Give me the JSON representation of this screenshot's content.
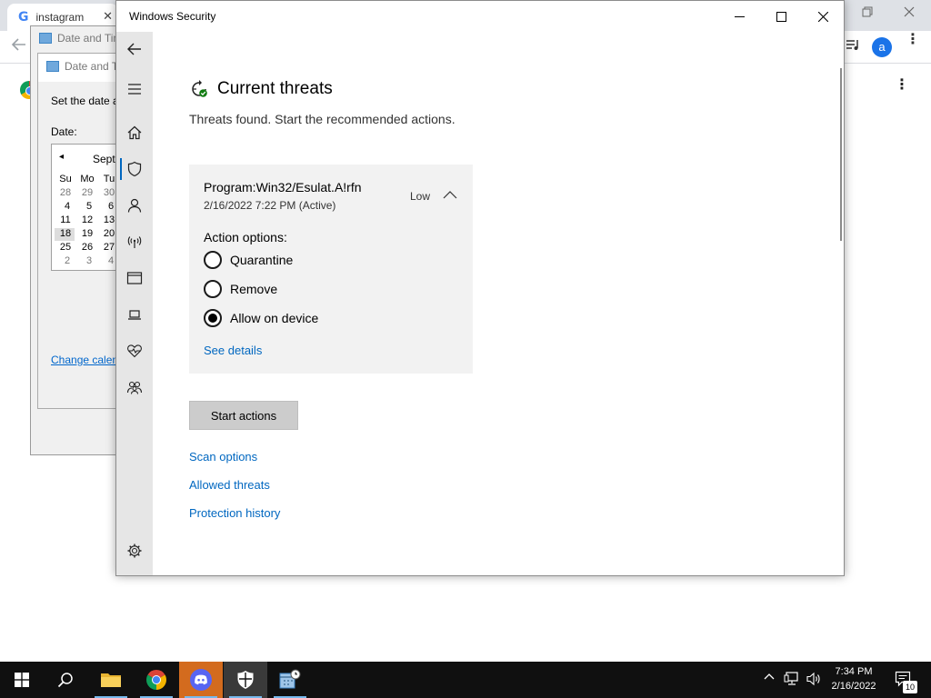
{
  "browser": {
    "tab_title": "instagram",
    "tab_close": "✕",
    "google_letter": "G",
    "avatar_letter": "a",
    "kebab": "⋮",
    "page_kebab": "⋮"
  },
  "date_time": {
    "title_outer": "Date and Tim",
    "title_inner": "Date and T",
    "set_date_text": "Set the date a",
    "date_label": "Date:",
    "month_label": "Septe",
    "prev_arrow": "◂",
    "weekdays": [
      "Su",
      "Mo",
      "Tu"
    ],
    "weeks": [
      [
        "28",
        "29",
        "30"
      ],
      [
        "4",
        "5",
        "6"
      ],
      [
        "11",
        "12",
        "13"
      ],
      [
        "18",
        "19",
        "20"
      ],
      [
        "25",
        "26",
        "27"
      ],
      [
        "2",
        "3",
        "4"
      ]
    ],
    "change_calendar_link": "Change calen"
  },
  "security": {
    "window_title": "Windows Security",
    "page_title": "Current threats",
    "page_subtitle": "Threats found. Start the recommended actions.",
    "threat": {
      "name": "Program:Win32/Esulat.A!rfn",
      "date": "2/16/2022 7:22 PM (Active)",
      "level": "Low",
      "action_options_label": "Action options:",
      "options": [
        {
          "label": "Quarantine",
          "checked": false
        },
        {
          "label": "Remove",
          "checked": false
        },
        {
          "label": "Allow on device",
          "checked": true
        }
      ],
      "see_details": "See details"
    },
    "start_actions": "Start actions",
    "links": [
      "Scan options",
      "Allowed threats",
      "Protection history"
    ],
    "nav_icons": [
      "back-arrow-icon",
      "hamburger-menu-icon",
      "home-icon",
      "shield-icon",
      "account-icon",
      "wireless-icon",
      "app-browser-icon",
      "laptop-icon",
      "heart-pulse-icon",
      "family-icon",
      "settings-gear-icon"
    ],
    "accent_color": "#0067c0"
  },
  "taskbar": {
    "time": "7:34 PM",
    "date": "2/16/2022",
    "notification_count": "10",
    "pinned": [
      "windows-start-icon",
      "search-icon",
      "file-explorer-icon",
      "chrome-icon",
      "discord-icon",
      "windows-security-icon",
      "date-time-control-panel-icon"
    ]
  }
}
